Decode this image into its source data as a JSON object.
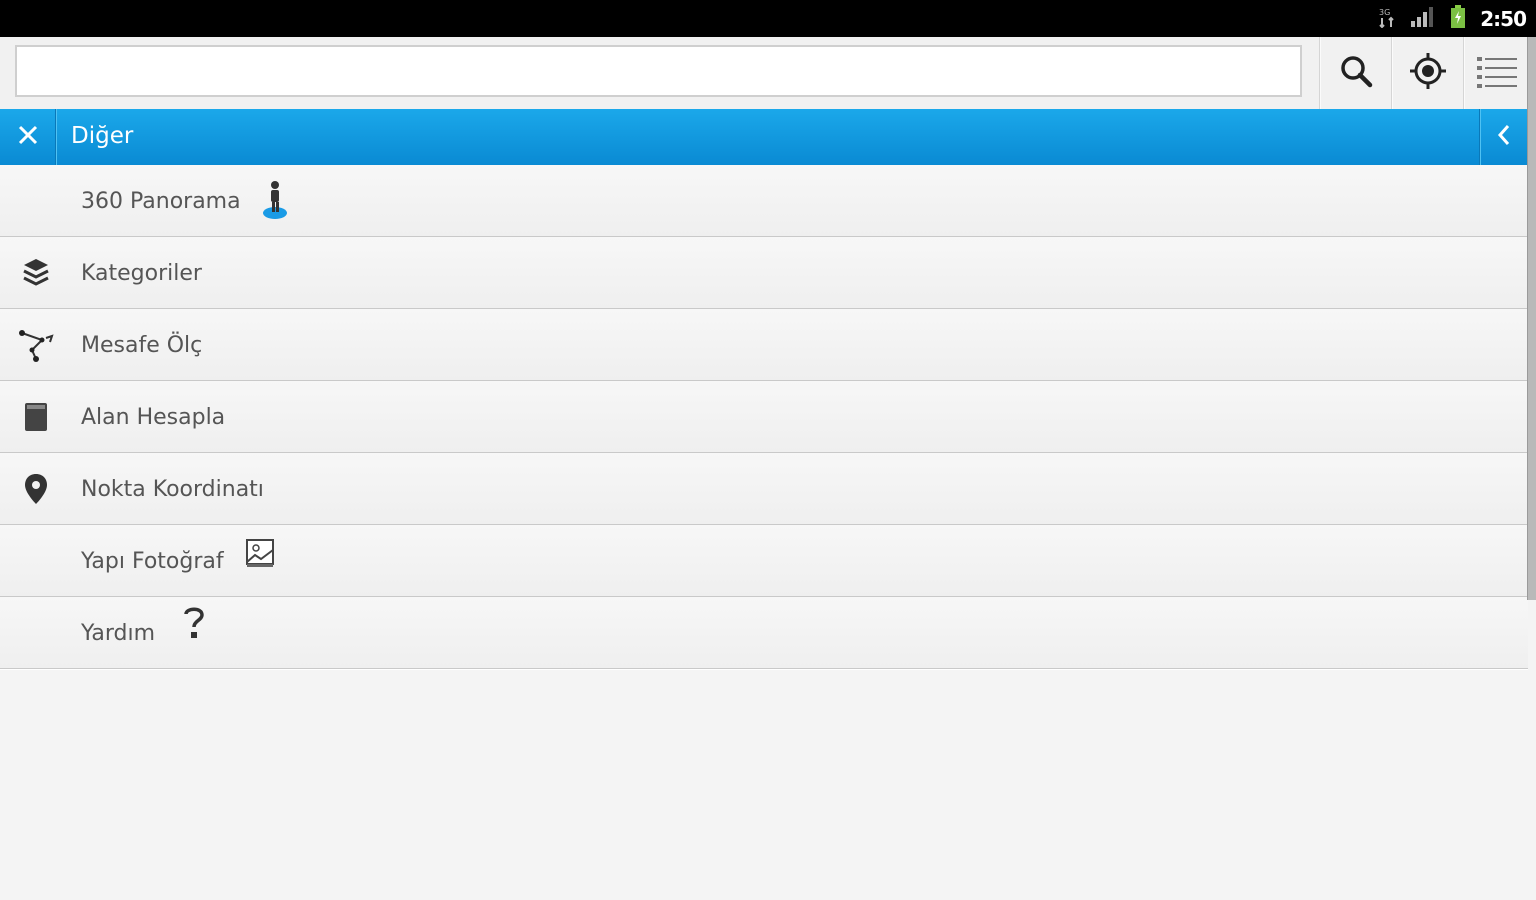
{
  "status_bar": {
    "time": "2:50",
    "icons": [
      "network-3g-icon",
      "signal-icon",
      "battery-icon"
    ]
  },
  "search": {
    "value": "",
    "placeholder": ""
  },
  "toolbar": {
    "icons": [
      "search-icon",
      "locate-icon",
      "list-icon"
    ]
  },
  "header": {
    "title": "Diğer",
    "close_icon": "close-icon",
    "back_icon": "chevron-left-icon"
  },
  "menu": {
    "items": [
      {
        "label": "360 Panorama",
        "icon": "pegman-icon"
      },
      {
        "label": "Kategoriler",
        "icon": "layers-icon"
      },
      {
        "label": "Mesafe Ölç",
        "icon": "measure-distance-icon"
      },
      {
        "label": "Alan Hesapla",
        "icon": "area-icon"
      },
      {
        "label": "Nokta Koordinatı",
        "icon": "map-pin-icon"
      },
      {
        "label": "Yapı Fotoğraf",
        "icon": "photo-icon"
      },
      {
        "label": "Yardım",
        "icon": "help-icon"
      }
    ]
  },
  "colors": {
    "header_blue": "#0a8ad3",
    "background": "#f4f4f4",
    "status_bar": "#000000"
  }
}
